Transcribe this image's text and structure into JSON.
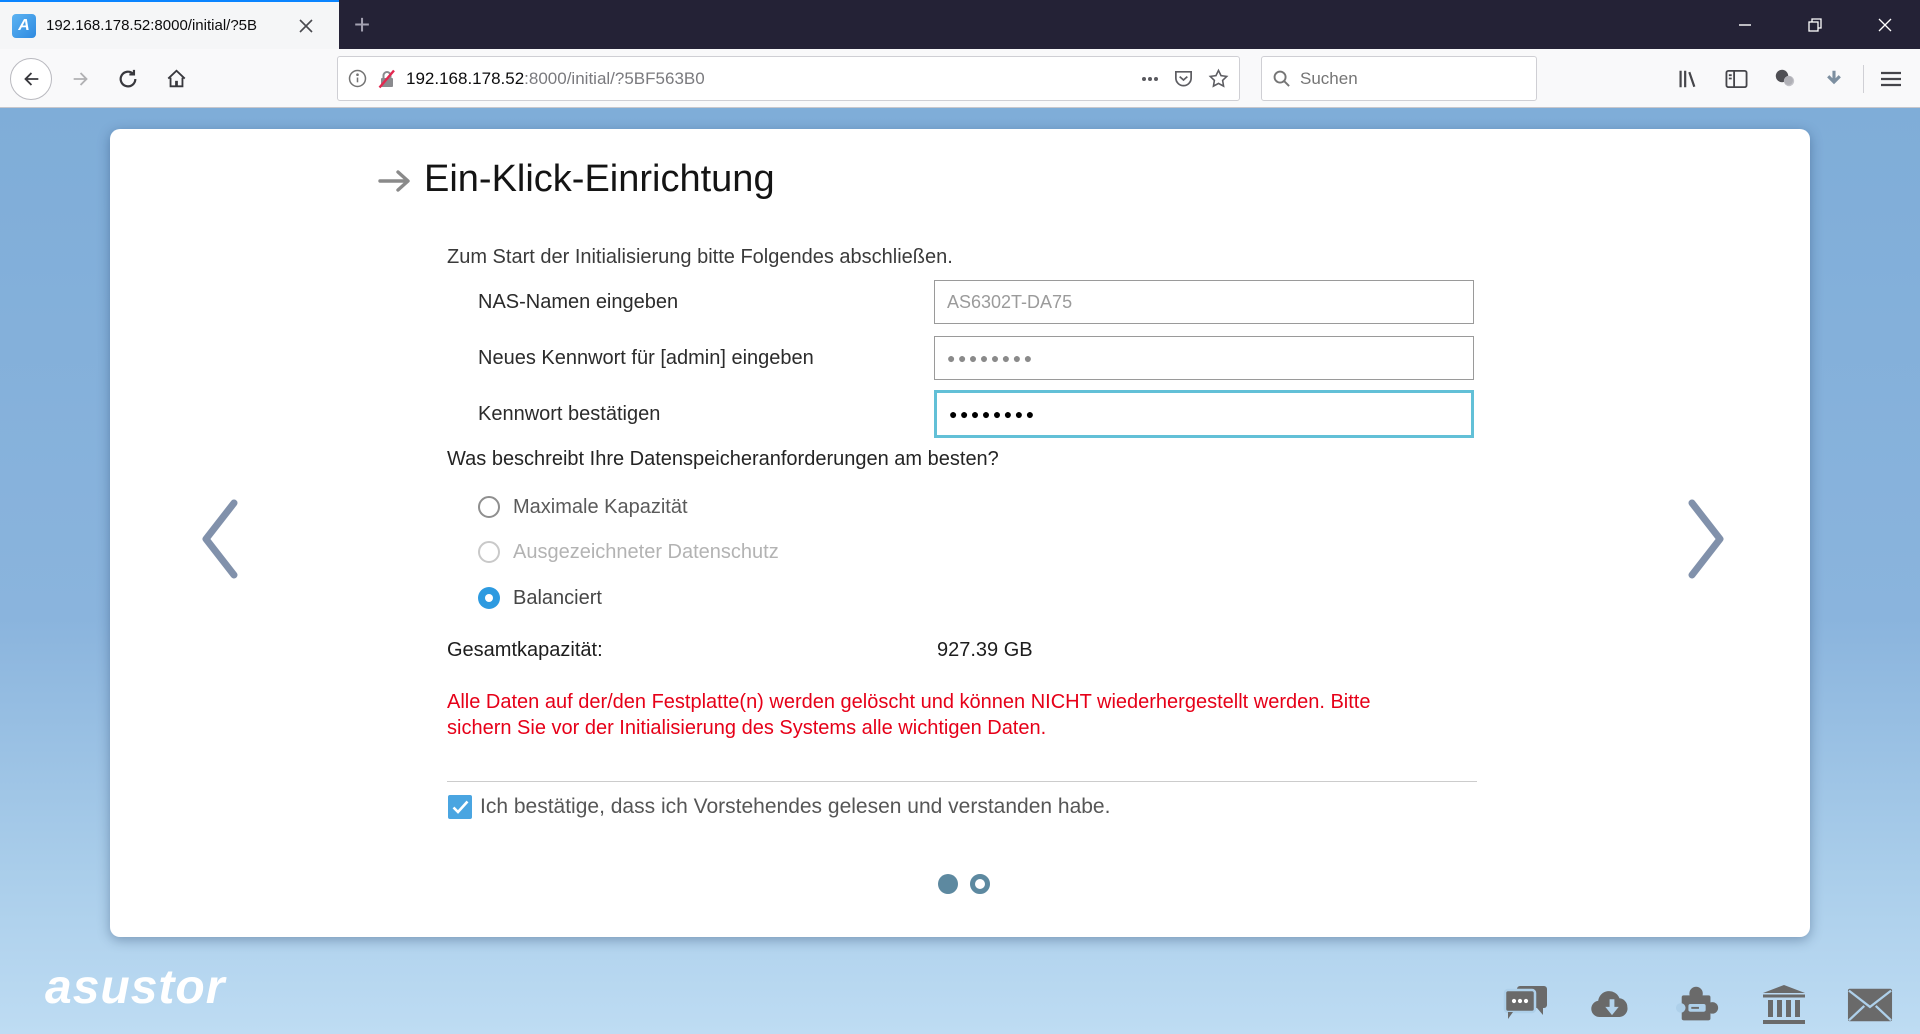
{
  "browser": {
    "tab_title": "192.168.178.52:8000/initial/?5B",
    "new_tab_label": "+",
    "url_host": "192.168.178.52",
    "url_rest": ":8000/initial/?5BF563B0",
    "search_placeholder": "Suchen"
  },
  "page": {
    "title": "Ein-Klick-Einrichtung",
    "intro": "Zum Start der Initialisierung bitte Folgendes abschließen.",
    "fields": [
      {
        "label": "NAS-Namen eingeben",
        "value": "AS6302T-DA75"
      },
      {
        "label": "Neues Kennwort für [admin] eingeben",
        "value": "●●●●●●●●"
      },
      {
        "label": "Kennwort bestätigen",
        "value": "●●●●●●●●"
      }
    ],
    "question": "Was beschreibt Ihre Datenspeicheranforderungen am besten?",
    "options": [
      {
        "label": "Maximale Kapazität",
        "selected": false,
        "disabled": false
      },
      {
        "label": "Ausgezeichneter Datenschutz",
        "selected": false,
        "disabled": true
      },
      {
        "label": "Balanciert",
        "selected": true,
        "disabled": false
      }
    ],
    "capacity_label": "Gesamtkapazität:",
    "capacity_value": "927.39 GB",
    "warning_line1": "Alle Daten auf der/den Festplatte(n) werden gelöscht und können NICHT wiederhergestellt werden. Bitte",
    "warning_line2": "sichern Sie vor der Initialisierung des Systems alle wichtigen Daten.",
    "confirm_label": "Ich bestätige, dass ich Vorstehendes gelesen und verstanden habe.",
    "pagination": {
      "total": 2,
      "active_index": 0
    }
  },
  "footer": {
    "logo": "asustor",
    "icon_names": [
      "chat",
      "cloud-download",
      "apps-puzzle",
      "datacenter",
      "mail"
    ]
  },
  "colors": {
    "titlebar": "#242236",
    "tab_accent": "#0a84ff",
    "page_blue_top": "#7fadd8",
    "page_blue_bottom": "#bedcf3",
    "focus_teal": "#62c0d7",
    "radio_blue": "#2d9ae0",
    "checkbox_blue": "#4aa5e1",
    "warning_red": "#e60018",
    "pagination_slate": "#5d89a0"
  }
}
